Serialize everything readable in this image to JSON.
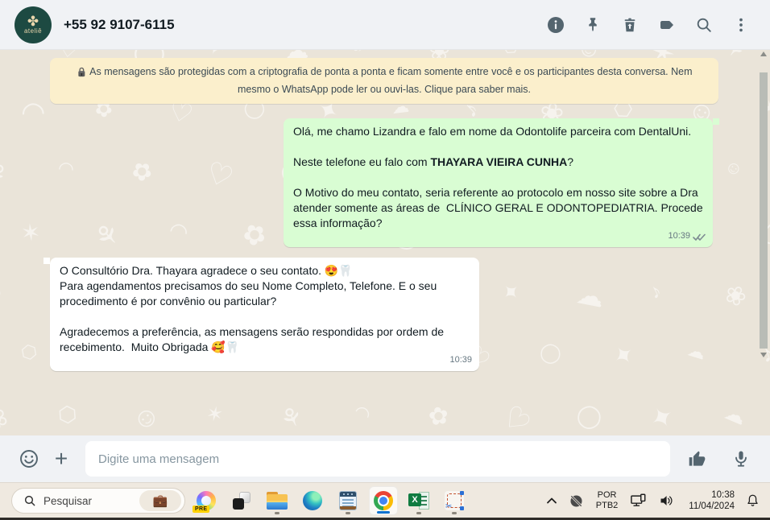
{
  "header": {
    "phone": "+55 92 9107-6115",
    "avatar_cross": "✤",
    "avatar_word": "ateliê",
    "icons": [
      "info-icon",
      "pin-icon",
      "delete-icon",
      "label-icon",
      "search-icon",
      "kebab-menu-icon"
    ],
    "bg_color": "#f0f2f5",
    "icon_color": "#54656f"
  },
  "encryption_notice": {
    "text": "As mensagens são protegidas com a criptografia de ponta a ponta e ficam somente entre você e os participantes desta conversa. Nem mesmo o WhatsApp pode ler ou ouvi-las. Clique para saber mais.",
    "bg_color": "#FBEFCC"
  },
  "messages": {
    "outgoing": {
      "p1": "Olá, me chamo Lizandra e falo em nome da Odontolife parceira com DentalUni.",
      "p2_prefix": "Neste telefone eu falo com ",
      "p2_bold": "THAYARA VIEIRA CUNHA",
      "p2_suffix": "?",
      "p3": "O Motivo do meu contato, seria referente ao protocolo em nosso site sobre a Dra atender somente as áreas de  CLÍNICO GERAL E ODONTOPEDIATRIA. Procede essa informação?",
      "time": "10:39",
      "status": "delivered",
      "bubble_color": "#d9fdd3"
    },
    "incoming": {
      "p1": "O Consultório Dra. Thayara agradece o seu contato. 😍🦷",
      "p2": "Para agendamentos precisamos do seu Nome Completo, Telefone. E o seu procedimento é por convênio ou particular?",
      "p3": "Agradecemos a preferência, as mensagens serão respondidas por ordem de recebimento.  Muito Obrigada 🥰🦷",
      "time": "10:39",
      "bubble_color": "#ffffff"
    }
  },
  "composer": {
    "placeholder": "Digite uma mensagem",
    "icons": [
      "emoji-icon",
      "plus-icon",
      "thumbs-up-icon",
      "microphone-icon"
    ]
  },
  "taskbar": {
    "search_label": "Pesquisar",
    "search_highlight": "💼",
    "copilot_badge": "PRE",
    "excel_letter": "X",
    "apps": [
      "copilot",
      "task-view",
      "file-explorer",
      "edge",
      "notepad",
      "chrome",
      "excel",
      "snipping-tool"
    ],
    "active_app": "chrome",
    "running_apps": [
      "file-explorer",
      "notepad",
      "excel",
      "snipping-tool"
    ],
    "language_line1": "POR",
    "language_line2": "PTB2",
    "time": "10:38",
    "date": "11/04/2024",
    "active_underline_color": "#0b72d0",
    "bg_color": "#EFE9E0"
  }
}
